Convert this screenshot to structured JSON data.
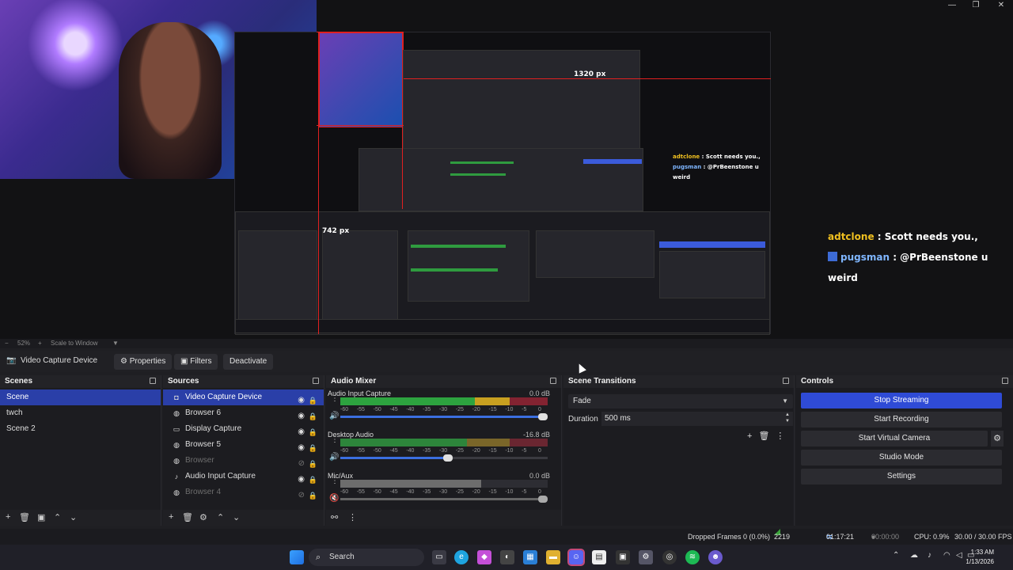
{
  "window": {
    "controls": [
      "—",
      "❐",
      "✕"
    ]
  },
  "preview": {
    "nested_dim_1": "1320 px",
    "nested_dim_2": "742 px",
    "inner_chat": [
      {
        "user": "adtclone",
        "text": " : Scott needs you.,"
      },
      {
        "user": "pugsman",
        "text": " : @PrBeenstone u weird"
      }
    ]
  },
  "chat_overlay": [
    {
      "user": "adtclone",
      "text": " : Scott needs you.,"
    },
    {
      "user": "pugsman",
      "text": " : @PrBeenstone u weird"
    }
  ],
  "zoom": {
    "minus": "−",
    "level": "52%",
    "plus": "+",
    "mode": "Scale to Window",
    "arrow": "▼"
  },
  "source_toolbar": {
    "selected_source": "Video Capture Device",
    "properties": "Properties",
    "filters": "Filters",
    "deactivate": "Deactivate"
  },
  "scenes": {
    "title": "Scenes",
    "items": [
      "Scene",
      "twch",
      "Scene 2"
    ]
  },
  "sources": {
    "title": "Sources",
    "items": [
      {
        "name": "Video Capture Device",
        "icon": "camera-icon",
        "visible": true
      },
      {
        "name": "Browser 6",
        "icon": "globe-icon",
        "visible": true
      },
      {
        "name": "Display Capture",
        "icon": "monitor-icon",
        "visible": true
      },
      {
        "name": "Browser 5",
        "icon": "globe-icon",
        "visible": true
      },
      {
        "name": "Browser",
        "icon": "globe-icon",
        "visible": false
      },
      {
        "name": "Audio Input Capture",
        "icon": "mic-icon",
        "visible": true
      },
      {
        "name": "Browser 4",
        "icon": "globe-icon",
        "visible": false
      }
    ]
  },
  "mixer": {
    "title": "Audio Mixer",
    "scale": [
      "-60",
      "-55",
      "-50",
      "-45",
      "-40",
      "-35",
      "-30",
      "-25",
      "-20",
      "-15",
      "-10",
      "-5",
      "0"
    ],
    "channels": [
      {
        "name": "Audio Input Capture",
        "db": "0.0 dB",
        "level": 0.82,
        "volume": 1.0
      },
      {
        "name": "Desktop Audio",
        "db": "-16.8 dB",
        "level": 0.6,
        "volume": 0.52
      },
      {
        "name": "Mic/Aux",
        "db": "0.0 dB",
        "level": 0.68,
        "volume": 1.0,
        "muted": true
      }
    ]
  },
  "transitions": {
    "title": "Scene Transitions",
    "selected": "Fade",
    "duration_label": "Duration",
    "duration_value": "500 ms"
  },
  "controls": {
    "title": "Controls",
    "stop_streaming": "Stop Streaming",
    "start_recording": "Start Recording",
    "start_virtual_camera": "Start Virtual Camera",
    "studio_mode": "Studio Mode",
    "settings": "Settings"
  },
  "status": {
    "dropped": "Dropped Frames 0 (0.0%)",
    "bitrate": "2219 kbps",
    "stream_time": "01:17:21",
    "rec_time": "00:00:00",
    "cpu": "CPU: 0.9%",
    "fps": "30.00 / 30.00 FPS"
  },
  "taskbar": {
    "search": "Search",
    "time": "1:33 AM",
    "date": "1/13/2026"
  }
}
